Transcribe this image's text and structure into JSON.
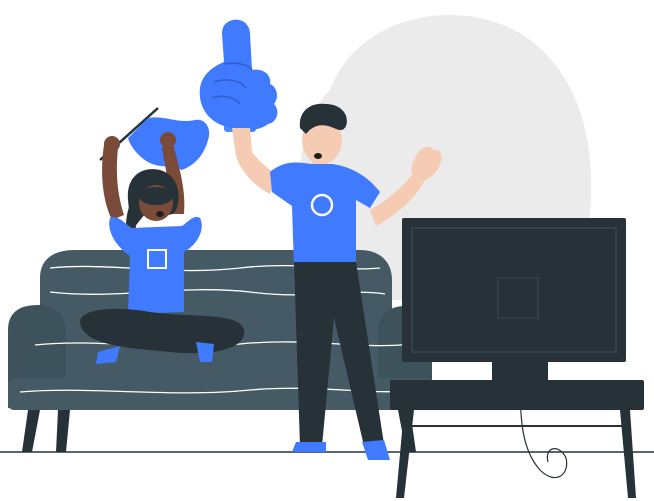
{
  "illustration": {
    "kind": "vector illustration",
    "colors": {
      "background": "#ffffff",
      "blob": "#ebebeb",
      "sofa": "#455a64",
      "sofa_dark": "#37474f",
      "sofa_lines": "#ffffff",
      "tv": "#263238",
      "tv_screen": "#263238",
      "tv_stand": "#263238",
      "shirt": "#407bff",
      "foam_hand": "#407bff",
      "flag": "#407bff",
      "pants": "#263238",
      "skin_dark": "#7a4b38",
      "skin_light": "#f5cbb3",
      "hair": "#263238",
      "floor": "#263238"
    },
    "icons": [
      "foam-finger-icon",
      "flag-icon",
      "circle-shirt-logo",
      "square-shirt-logo",
      "tv-icon",
      "sofa-icon"
    ]
  }
}
